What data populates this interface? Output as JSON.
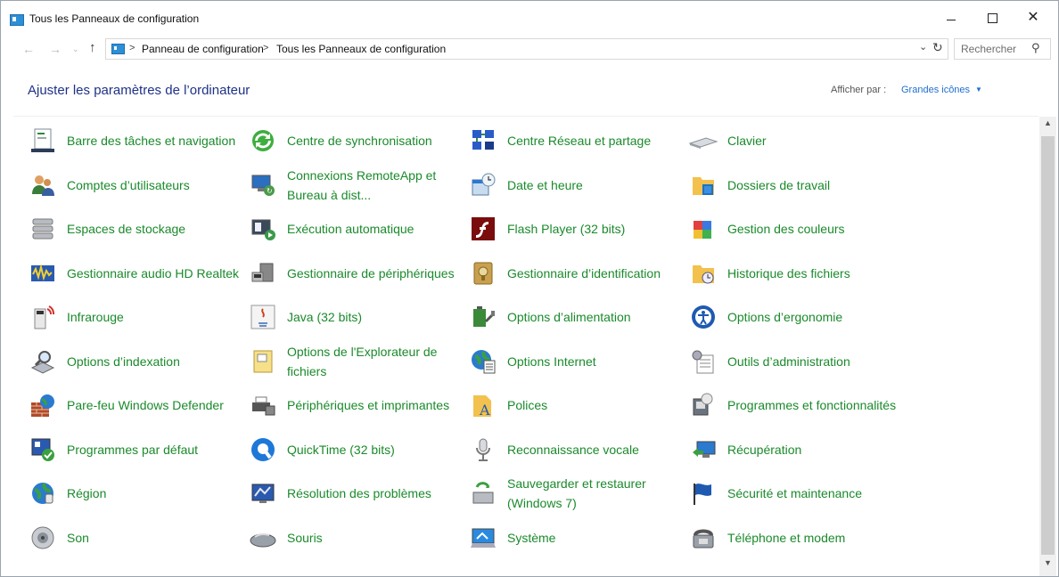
{
  "window": {
    "title": "Tous les Panneaux de configuration",
    "minimize": "—",
    "maximize": "☐",
    "close": "✕"
  },
  "address": {
    "crumb1": "Panneau de configuration",
    "crumb2": "Tous les Panneaux de configuration",
    "separator": ">",
    "search_placeholder": "Rechercher"
  },
  "header": {
    "title": "Ajuster les paramètres de l’ordinateur",
    "view_by_label": "Afficher par :",
    "view_by_value": "Grandes icônes"
  },
  "items": [
    {
      "label": "Barre des tâches et navigation",
      "icon": "taskbar-icon"
    },
    {
      "label": "Centre de synchronisation",
      "icon": "sync-icon"
    },
    {
      "label": "Centre Réseau et partage",
      "icon": "network-icon"
    },
    {
      "label": "Clavier",
      "icon": "keyboard-icon"
    },
    {
      "label": "Comptes d’utilisateurs",
      "icon": "users-icon"
    },
    {
      "label": "Connexions RemoteApp et Bureau à dist...",
      "icon": "remoteapp-icon"
    },
    {
      "label": "Date et heure",
      "icon": "datetime-icon"
    },
    {
      "label": "Dossiers de travail",
      "icon": "work-folders-icon"
    },
    {
      "label": "Espaces de stockage",
      "icon": "storage-icon"
    },
    {
      "label": "Exécution automatique",
      "icon": "autoplay-icon"
    },
    {
      "label": "Flash Player (32 bits)",
      "icon": "flash-icon"
    },
    {
      "label": "Gestion des couleurs",
      "icon": "color-icon"
    },
    {
      "label": "Gestionnaire audio HD Realtek",
      "icon": "realtek-icon"
    },
    {
      "label": "Gestionnaire de périphériques",
      "icon": "device-manager-icon"
    },
    {
      "label": "Gestionnaire d’identification",
      "icon": "credential-icon"
    },
    {
      "label": "Historique des fichiers",
      "icon": "file-history-icon"
    },
    {
      "label": "Infrarouge",
      "icon": "infrared-icon"
    },
    {
      "label": "Java (32 bits)",
      "icon": "java-icon"
    },
    {
      "label": "Options d’alimentation",
      "icon": "power-icon"
    },
    {
      "label": "Options d’ergonomie",
      "icon": "ease-of-access-icon"
    },
    {
      "label": "Options d’indexation",
      "icon": "indexing-icon"
    },
    {
      "label": "Options de l'Explorateur de fichiers",
      "icon": "explorer-options-icon"
    },
    {
      "label": "Options Internet",
      "icon": "internet-options-icon"
    },
    {
      "label": "Outils d’administration",
      "icon": "admin-tools-icon"
    },
    {
      "label": "Pare-feu Windows Defender",
      "icon": "firewall-icon"
    },
    {
      "label": "Périphériques et imprimantes",
      "icon": "printers-icon"
    },
    {
      "label": "Polices",
      "icon": "fonts-icon"
    },
    {
      "label": "Programmes et fonctionnalités",
      "icon": "programs-icon"
    },
    {
      "label": "Programmes par défaut",
      "icon": "default-programs-icon"
    },
    {
      "label": "QuickTime (32 bits)",
      "icon": "quicktime-icon"
    },
    {
      "label": "Reconnaissance vocale",
      "icon": "microphone-icon"
    },
    {
      "label": "Récupération",
      "icon": "recovery-icon"
    },
    {
      "label": "Région",
      "icon": "region-icon"
    },
    {
      "label": "Résolution des problèmes",
      "icon": "troubleshooting-icon"
    },
    {
      "label": "Sauvegarder et restaurer (Windows 7)",
      "icon": "backup-icon"
    },
    {
      "label": "Sécurité et maintenance",
      "icon": "security-flag-icon"
    },
    {
      "label": "Son",
      "icon": "sound-icon"
    },
    {
      "label": "Souris",
      "icon": "mouse-icon"
    },
    {
      "label": "Système",
      "icon": "system-icon"
    },
    {
      "label": "Téléphone et modem",
      "icon": "phone-modem-icon"
    }
  ],
  "colors": {
    "link_green": "#1a8a2b",
    "heading_blue": "#1e3287",
    "accent_blue": "#1f6fcf"
  }
}
